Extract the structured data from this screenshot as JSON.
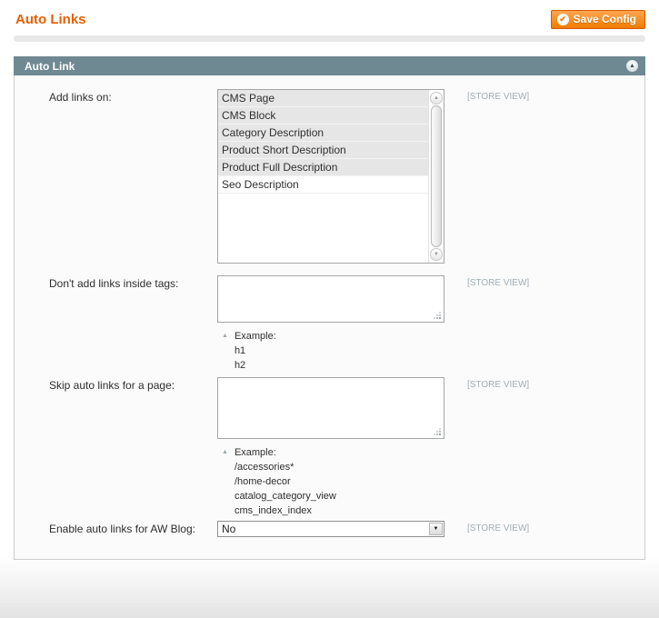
{
  "page": {
    "title": "Auto Links"
  },
  "toolbar": {
    "save_label": "Save Config"
  },
  "section": {
    "title": "Auto Link"
  },
  "icons": {
    "save_check": "✔",
    "collapse": "▲",
    "scroll_up": "▲",
    "scroll_down": "▼",
    "select_arrow": "▼",
    "note_arrow": "▲"
  },
  "colors": {
    "accent_orange": "#eb5e00",
    "button_gradient_top": "#ffa550",
    "button_gradient_bottom": "#f07c00",
    "section_header_bg": "#6f8992",
    "scope_label": "#a2aeb4",
    "selected_option_bg": "#e6e6e6"
  },
  "fields": {
    "add_links_on": {
      "label": "Add links on:",
      "scope": "[STORE VIEW]",
      "options": [
        {
          "label": "CMS Page",
          "selected": true
        },
        {
          "label": "CMS Block",
          "selected": true
        },
        {
          "label": "Category Description",
          "selected": true
        },
        {
          "label": "Product Short Description",
          "selected": true
        },
        {
          "label": "Product Full Description",
          "selected": true
        },
        {
          "label": "Seo Description",
          "selected": false
        }
      ]
    },
    "dont_add_inside_tags": {
      "label": "Don't add links inside tags:",
      "scope": "[STORE VIEW]",
      "value": "",
      "note_title": "Example:",
      "note_lines": [
        "h1",
        "h2"
      ]
    },
    "skip_for_page": {
      "label": "Skip auto links for a page:",
      "scope": "[STORE VIEW]",
      "value": "",
      "note_title": "Example:",
      "note_lines": [
        "/accessories*",
        "/home-decor",
        "catalog_category_view",
        "cms_index_index"
      ]
    },
    "enable_aw_blog": {
      "label": "Enable auto links for AW Blog:",
      "scope": "[STORE VIEW]",
      "value": "No"
    }
  }
}
